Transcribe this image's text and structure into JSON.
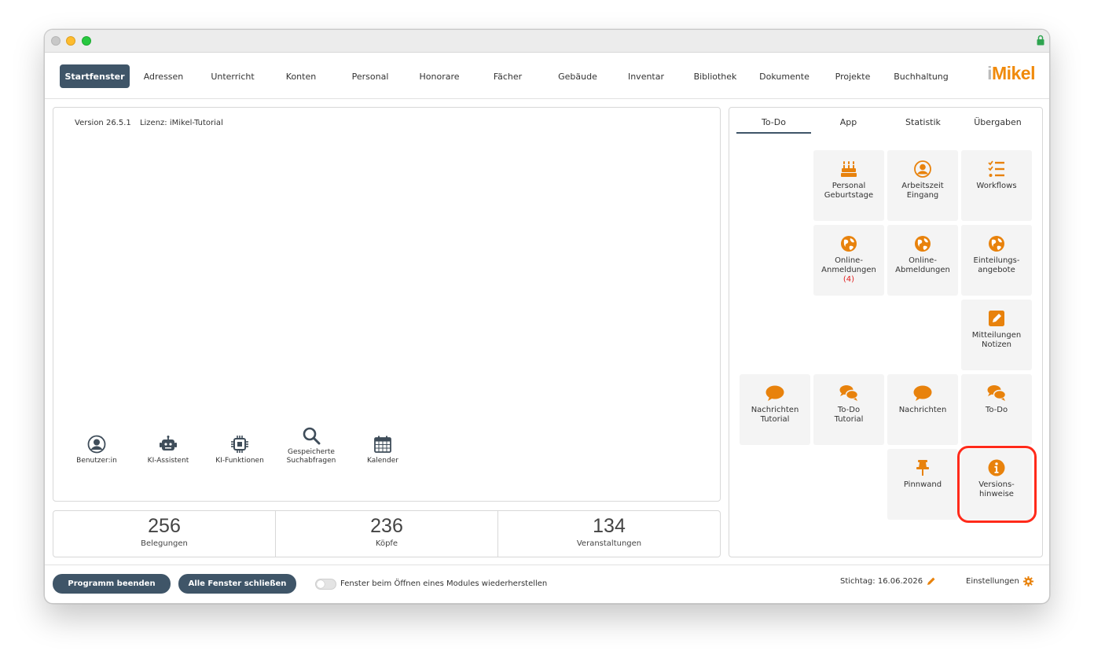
{
  "colors": {
    "accent": "#f08a0b",
    "nav_active": "#3f5568",
    "badge": "#e02020",
    "highlight": "#ff2a1a"
  },
  "menu": [
    "Startfenster",
    "Adressen",
    "Unterricht",
    "Konten",
    "Personal",
    "Honorare",
    "Fächer",
    "Gebäude",
    "Inventar",
    "Bibliothek",
    "Dokumente",
    "Projekte",
    "Buchhaltung"
  ],
  "logo": {
    "prefix": "i",
    "name": "Mikel"
  },
  "version": {
    "text": "Version 26.5.1",
    "license": "Lizenz: iMikel-Tutorial"
  },
  "tools": [
    {
      "label": "Benutzer:in",
      "icon": "user-icon"
    },
    {
      "label": "KI-Assistent",
      "icon": "robot-icon"
    },
    {
      "label": "KI-Funktionen",
      "icon": "chip-icon"
    },
    {
      "label": "Gespeicherte\nSuchabfragen",
      "icon": "search-icon"
    },
    {
      "label": "Kalender",
      "icon": "calendar-icon"
    }
  ],
  "stats": [
    {
      "value": "256",
      "label": "Belegungen"
    },
    {
      "value": "236",
      "label": "Köpfe"
    },
    {
      "value": "134",
      "label": "Veranstaltungen"
    }
  ],
  "tabs": [
    "To-Do",
    "App",
    "Statistik",
    "Übergaben"
  ],
  "active_tab": "To-Do",
  "tiles": {
    "geburtstage": "Personal\nGeburtstage",
    "arbeitszeit": "Arbeitszeit\nEingang",
    "workflows": "Workflows",
    "anmeldungen": "Online-\nAnmeldungen",
    "anmeldungen_count": "(4)",
    "abmeldungen": "Online-\nAbmeldungen",
    "einteilung": "Einteilungs-\nangebote",
    "mitteilungen": "Mitteilungen\nNotizen",
    "nachrichten_tutorial": "Nachrichten\nTutorial",
    "todo_tutorial": "To-Do\nTutorial",
    "nachrichten": "Nachrichten",
    "todo": "To-Do",
    "pinnwand": "Pinnwand",
    "versionshinweise": "Versions-\nhinweise"
  },
  "footer": {
    "quit": "Programm beenden",
    "close_all": "Alle Fenster schließen",
    "toggle_label": "Fenster beim Öffnen eines Modules wiederherstellen",
    "stichtag": "Stichtag: 16.06.2026",
    "settings": "Einstellungen"
  }
}
